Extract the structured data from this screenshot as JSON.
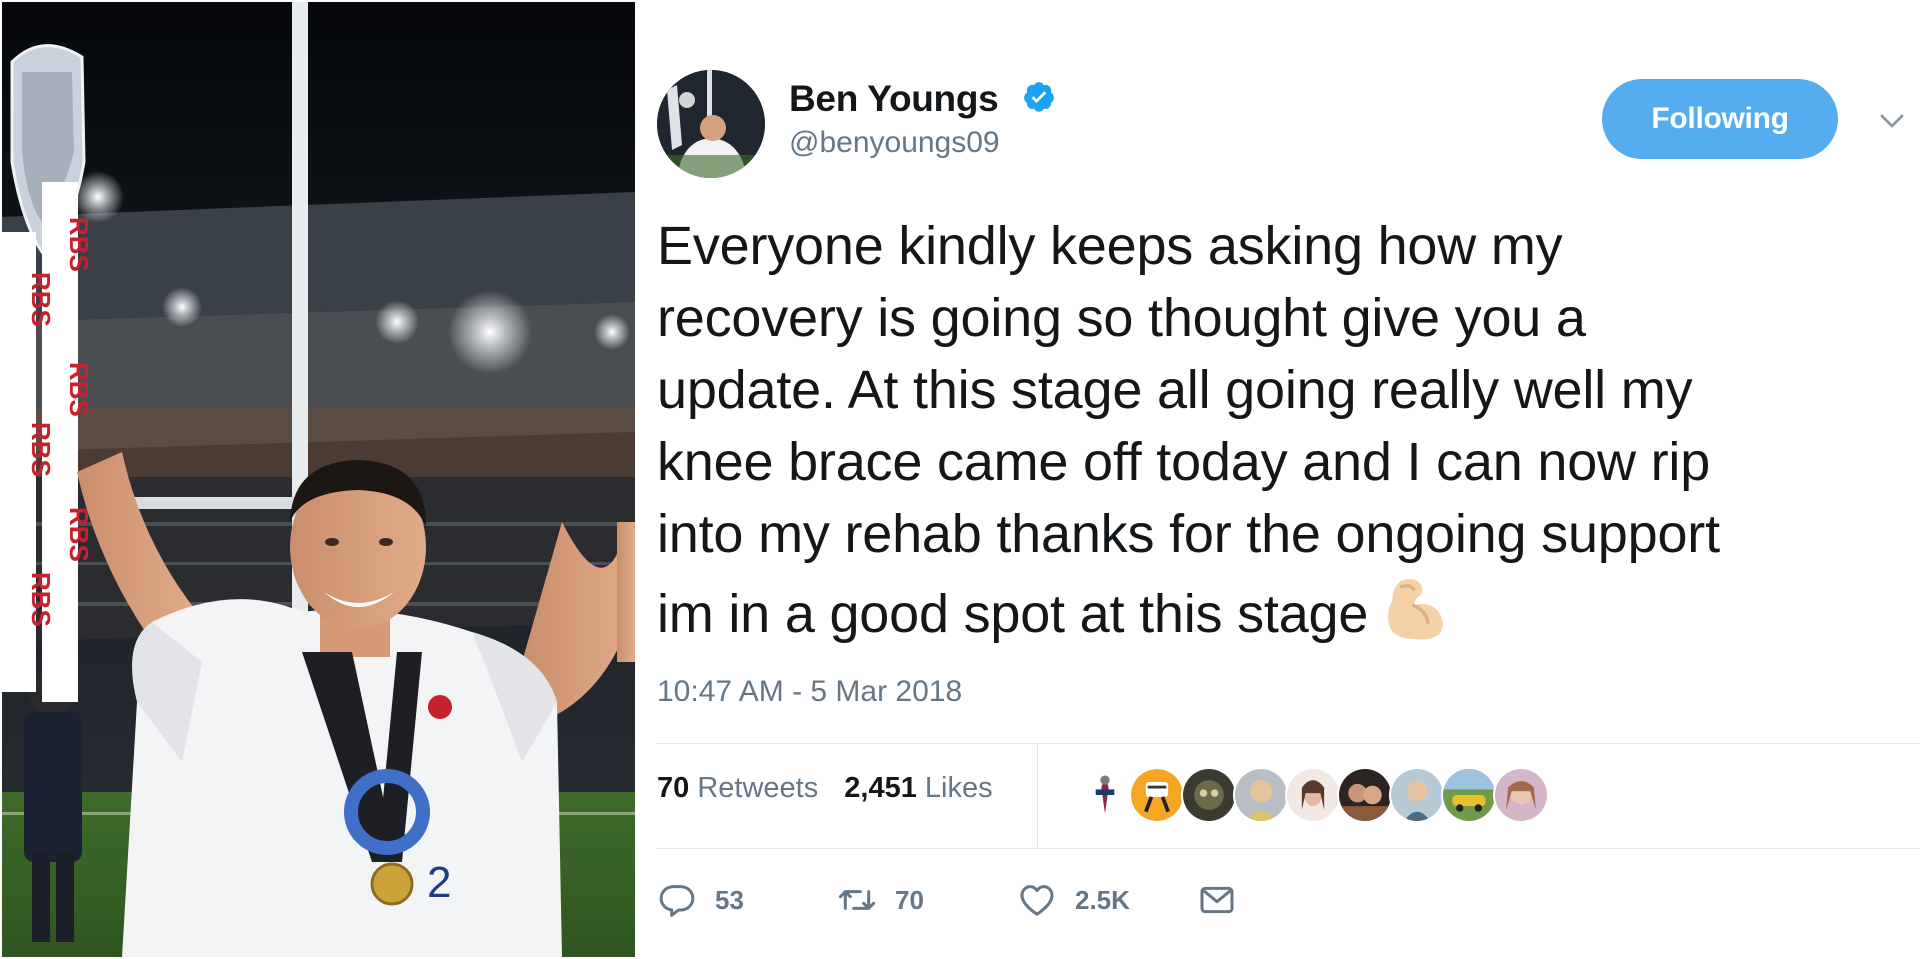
{
  "photo": {
    "icon": "rugby-trophy-celebration-photo",
    "banner_text": "RBS",
    "shirt_number": "2"
  },
  "tweet": {
    "author": {
      "name": "Ben Youngs",
      "handle": "@benyoungs09",
      "verified": true,
      "verified_icon": "verified-badge-icon"
    },
    "follow_button_label": "Following",
    "menu_icon": "chevron-down-icon",
    "text_lines": [
      "Everyone kindly keeps asking how my",
      "recovery is going so thought give you a",
      "update. At this stage all going really well my",
      "knee brace came off today and I can now rip",
      "into my rehab thanks for the ongoing support",
      "im in a good spot at this stage"
    ],
    "emoji": "flexed-biceps-emoji",
    "timestamp": "10:47 AM - 5 Mar 2018",
    "stats": {
      "retweets_count": "70",
      "retweets_label": "Retweets",
      "likes_count": "2,451",
      "likes_label": "Likes"
    },
    "liker_avatars_count": 9,
    "actions": {
      "reply_count": "53",
      "retweet_count": "70",
      "like_count": "2.5K",
      "reply_icon": "reply-icon",
      "retweet_icon": "retweet-icon",
      "like_icon": "heart-icon",
      "message_icon": "envelope-icon"
    },
    "colors": {
      "accent": "#55acee",
      "secondary_text": "#657786",
      "primary_text": "#14171a",
      "divider": "#e1e8ed"
    }
  }
}
